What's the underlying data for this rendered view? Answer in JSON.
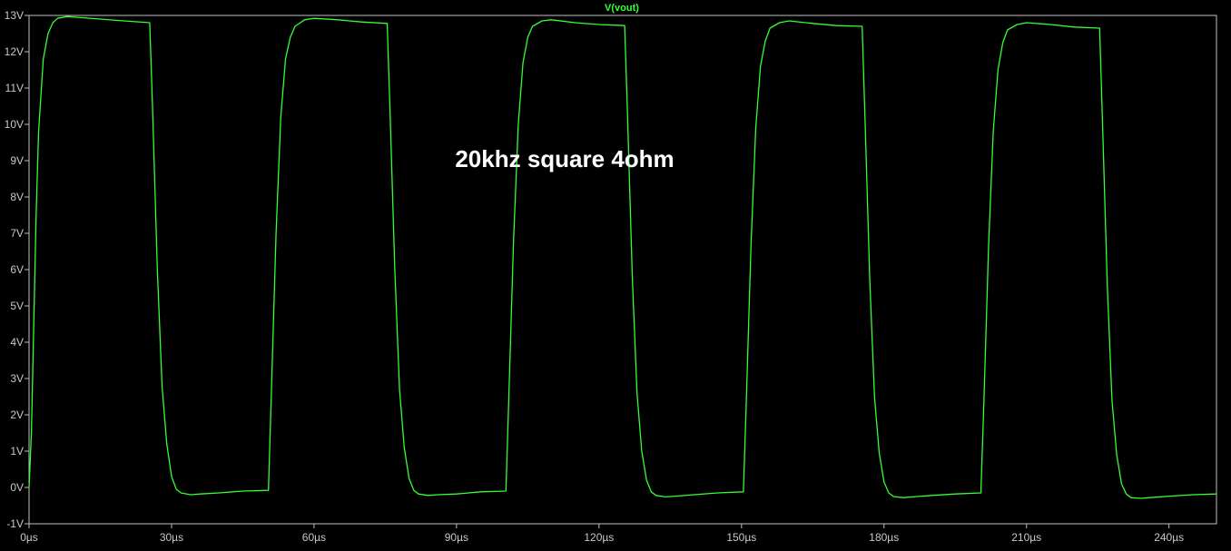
{
  "chart_data": {
    "type": "line",
    "title": "V(vout)",
    "annotation": "20khz square 4ohm",
    "xlabel": "",
    "ylabel": "",
    "x_unit": "µs",
    "y_unit": "V",
    "xlim": [
      0,
      250
    ],
    "ylim": [
      -1,
      13
    ],
    "x_ticks": [
      0,
      30,
      60,
      90,
      120,
      150,
      180,
      210,
      240
    ],
    "x_tick_labels": [
      "0µs",
      "30µs",
      "60µs",
      "90µs",
      "120µs",
      "150µs",
      "180µs",
      "210µs",
      "240µs"
    ],
    "y_ticks": [
      13,
      12,
      11,
      10,
      9,
      8,
      7,
      6,
      5,
      4,
      3,
      2,
      1,
      0,
      -1
    ],
    "y_tick_labels": [
      "13V",
      "12V",
      "11V",
      "10V",
      "9V",
      "8V",
      "7V",
      "6V",
      "5V",
      "4V",
      "3V",
      "2V",
      "1V",
      "0V",
      "-1V"
    ],
    "grid": false,
    "colors": {
      "background": "#000000",
      "axes": "#c0c0c0",
      "trace": "#33ff33",
      "tick_labels": "#c8c8c8",
      "annotation": "#ffffff"
    },
    "series": [
      {
        "name": "V(vout)",
        "x": [
          0,
          0.5,
          1,
          1.5,
          2,
          3,
          4,
          5,
          6,
          8,
          10,
          15,
          20,
          25.4,
          26,
          27,
          28,
          29,
          30,
          31,
          32,
          34,
          36,
          40,
          45,
          50.4,
          51,
          52,
          53,
          54,
          55,
          56,
          58,
          60,
          65,
          70,
          75.4,
          76,
          77,
          78,
          79,
          80,
          81,
          82,
          84,
          86,
          90,
          95,
          100.4,
          101,
          102,
          103,
          104,
          105,
          106,
          108,
          110,
          115,
          120,
          125.4,
          126,
          127,
          128,
          129,
          130,
          131,
          132,
          134,
          136,
          140,
          145,
          150.4,
          151,
          152,
          153,
          154,
          155,
          156,
          158,
          160,
          165,
          170,
          175.4,
          176,
          177,
          178,
          179,
          180,
          181,
          182,
          184,
          186,
          190,
          195,
          200.4,
          201,
          202,
          203,
          204,
          205,
          206,
          208,
          210,
          215,
          220,
          225.4,
          226,
          227,
          228,
          229,
          230,
          231,
          232,
          234,
          236,
          240,
          245,
          250
        ],
        "y": [
          0,
          1.5,
          4.5,
          7.5,
          9.8,
          11.8,
          12.5,
          12.8,
          12.92,
          12.97,
          12.95,
          12.9,
          12.85,
          12.8,
          10.5,
          6,
          2.8,
          1.2,
          0.3,
          -0.05,
          -0.15,
          -0.2,
          -0.18,
          -0.15,
          -0.1,
          -0.08,
          2.5,
          7,
          10.2,
          11.8,
          12.4,
          12.7,
          12.88,
          12.92,
          12.88,
          12.82,
          12.78,
          10.4,
          6,
          2.7,
          1.1,
          0.25,
          -0.08,
          -0.18,
          -0.22,
          -0.2,
          -0.18,
          -0.12,
          -0.1,
          2.4,
          6.8,
          10,
          11.7,
          12.4,
          12.7,
          12.85,
          12.88,
          12.8,
          12.75,
          12.72,
          10.3,
          5.8,
          2.6,
          1.0,
          0.2,
          -0.12,
          -0.22,
          -0.26,
          -0.24,
          -0.2,
          -0.15,
          -0.12,
          2.3,
          6.7,
          9.9,
          11.6,
          12.3,
          12.65,
          12.8,
          12.85,
          12.78,
          12.72,
          12.7,
          10.2,
          5.7,
          2.5,
          0.95,
          0.15,
          -0.15,
          -0.25,
          -0.28,
          -0.26,
          -0.22,
          -0.18,
          -0.15,
          2.2,
          6.6,
          9.8,
          11.5,
          12.25,
          12.6,
          12.75,
          12.8,
          12.75,
          12.68,
          12.65,
          10.1,
          5.6,
          2.4,
          0.9,
          0.1,
          -0.18,
          -0.28,
          -0.3,
          -0.28,
          -0.24,
          -0.2,
          -0.18
        ]
      }
    ]
  }
}
